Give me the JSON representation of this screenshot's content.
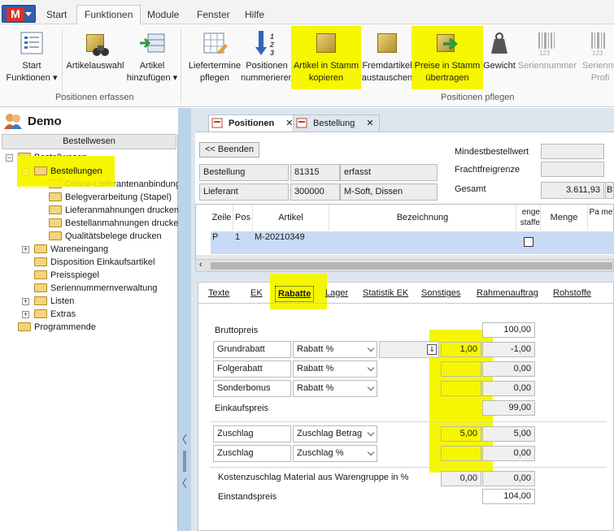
{
  "app": {
    "logo": "M"
  },
  "top_tabs": [
    "Start",
    "Funktionen",
    "Module",
    "Fenster",
    "Hilfe"
  ],
  "ribbon": {
    "buttons": [
      {
        "label1": "Start",
        "label2": "Funktionen ▾",
        "icon": "list-icon"
      },
      {
        "label1": "Artikelauswahl",
        "label2": "",
        "icon": "binoculars-icon"
      },
      {
        "label1": "Artikel",
        "label2": "hinzufügen ▾",
        "icon": "add-table-icon"
      },
      {
        "label1": "Liefertermine",
        "label2": "pflegen",
        "icon": "calendar-grid-icon"
      },
      {
        "label1": "Positionen",
        "label2": "nummerieren",
        "icon": "number-arrow-icon"
      },
      {
        "label1": "Artikel in Stamm",
        "label2": "kopieren",
        "icon": "cube-icon"
      },
      {
        "label1": "Fremdartikel",
        "label2": "austauschen",
        "icon": "cubes-icon"
      },
      {
        "label1": "Preise in Stamm",
        "label2": "übertragen",
        "icon": "cube-arrow-icon"
      },
      {
        "label1": "Gewicht",
        "label2": "",
        "icon": "weight-icon"
      },
      {
        "label1": "Seriennummer",
        "label2": "",
        "icon": "barcode-icon"
      },
      {
        "label1": "Seriennu",
        "label2": "Profi",
        "icon": "barcode-icon"
      }
    ],
    "groups": [
      "Positionen erfassen",
      "Positionen pflegen"
    ]
  },
  "left": {
    "title": "Demo",
    "header": "Bestellwesen",
    "tree": [
      "Bestellwesen",
      "Bestellungen",
      "Online-Lieferantenanbindung",
      "Belegverarbeitung (Stapel)",
      "Lieferanmahnungen drucken",
      "Bestellanmahnungen drucken",
      "Qualitätsbelege drucken",
      "Wareneingang",
      "Disposition Einkaufsartikel",
      "Preisspiegel",
      "Seriennummernverwaltung",
      "Listen",
      "Extras",
      "Programmende"
    ]
  },
  "doc_tabs": [
    "Positionen",
    "Bestellung"
  ],
  "header_fields": {
    "back_button": "<< Beenden",
    "bestellung_label": "Bestellung",
    "bestellung_nr": "81315",
    "bestellung_status": "erfasst",
    "lieferant_label": "Lieferant",
    "lieferant_nr": "300000",
    "lieferant_name": "M-Soft, Dissen",
    "mindest_label": "Mindestbestellwert",
    "fracht_label": "Frachtfreigrenze",
    "gesamt_label": "Gesamt",
    "gesamt_value": "3.611,93",
    "cut_value": "B"
  },
  "grid": {
    "columns": [
      "Zeile",
      "Pos",
      "Artikel",
      "Bezeichnung",
      "enge staffe",
      "Menge",
      "Pa me"
    ],
    "row": {
      "zeile": "P",
      "pos": "1",
      "artikel": "M-20210349"
    }
  },
  "sub_tabs": [
    "Texte",
    "EK",
    "Rabatte",
    "Lager",
    "Statistik EK",
    "Sonstiges",
    "Rahmenauftrag",
    "Rohstoffe"
  ],
  "rabatte": {
    "bruttopreis_label": "Bruttopreis",
    "bruttopreis": "100,00",
    "rows": [
      {
        "name": "Grundrabatt",
        "type": "Rabatt %",
        "input": "1,00",
        "value": "-1,00"
      },
      {
        "name": "Folgerabatt",
        "type": "Rabatt %",
        "input": "",
        "value": "0,00"
      },
      {
        "name": "Sonderbonus",
        "type": "Rabatt %",
        "input": "",
        "value": "0,00"
      }
    ],
    "einkaufspreis_label": "Einkaufspreis",
    "einkaufspreis": "99,00",
    "zuschlag_rows": [
      {
        "name": "Zuschlag",
        "type": "Zuschlag Betrag",
        "input": "5,00",
        "value": "5,00"
      },
      {
        "name": "Zuschlag",
        "type": "Zuschlag %",
        "input": "",
        "value": "0,00"
      }
    ],
    "kosten_label": "Kostenzuschlag Material aus Warengruppe in %",
    "kosten_input": "0,00",
    "kosten_value": "0,00",
    "einstand_label": "Einstandspreis",
    "einstand_value": "104,00"
  },
  "colors": {
    "highlight": "#f6f600",
    "selection_row": "#c8daf5",
    "splitter": "#bcd3ea"
  }
}
